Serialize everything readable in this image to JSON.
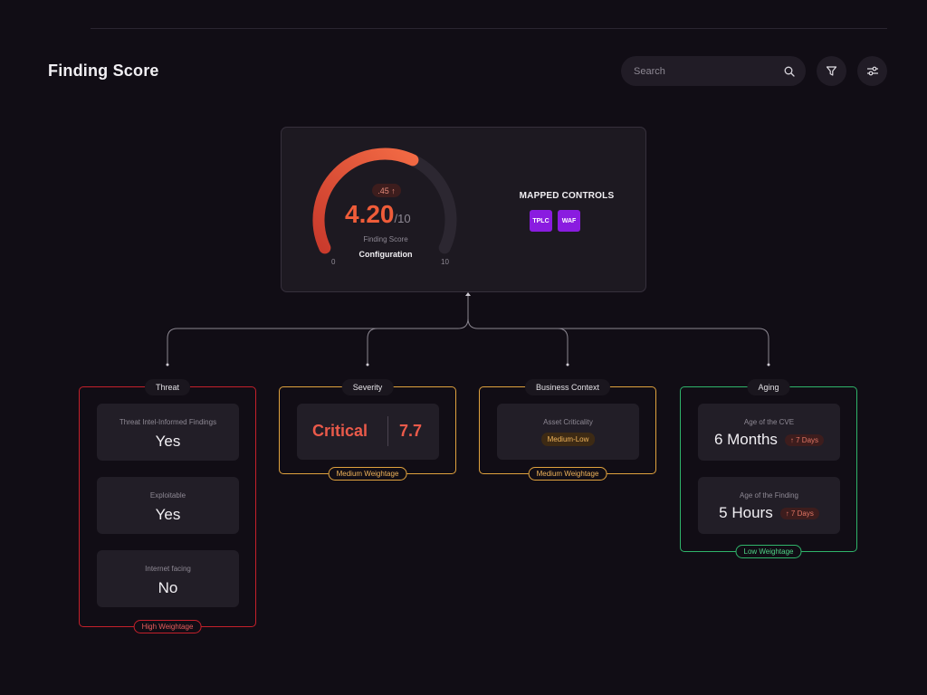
{
  "header": {
    "title": "Finding Score",
    "search_placeholder": "Search"
  },
  "score": {
    "value": "4.20",
    "max": "/10",
    "delta": ".45 ↑",
    "label": "Finding Score",
    "category": "Configuration",
    "gauge_min": "0",
    "gauge_max": "10",
    "fraction": 0.42
  },
  "mapped_controls": {
    "title": "MAPPED CONTROLS",
    "items": [
      "TPLC",
      "WAF"
    ]
  },
  "threat": {
    "title": "Threat",
    "weightage": "High Weightage",
    "items": [
      {
        "label": "Threat Intel-Informed Findings",
        "value": "Yes"
      },
      {
        "label": "Exploitable",
        "value": "Yes"
      },
      {
        "label": "Internet facing",
        "value": "No"
      }
    ]
  },
  "severity": {
    "title": "Severity",
    "weightage": "Medium Weightage",
    "level": "Critical",
    "score": "7.7"
  },
  "business": {
    "title": "Business Context",
    "weightage": "Medium Weightage",
    "label": "Asset Criticality",
    "value": "Medium-Low"
  },
  "aging": {
    "title": "Aging",
    "weightage": "Low Weightage",
    "items": [
      {
        "label": "Age of the CVE",
        "value": "6 Months",
        "trend": "↑ 7 Days"
      },
      {
        "label": "Age of the Finding",
        "value": "5 Hours",
        "trend": "↑ 7 Days"
      }
    ]
  },
  "colors": {
    "accent": "#ef5c39",
    "high": "#c4202b",
    "medium": "#e0a23e",
    "low": "#2fb46a",
    "chip": "#8a1ce0"
  }
}
